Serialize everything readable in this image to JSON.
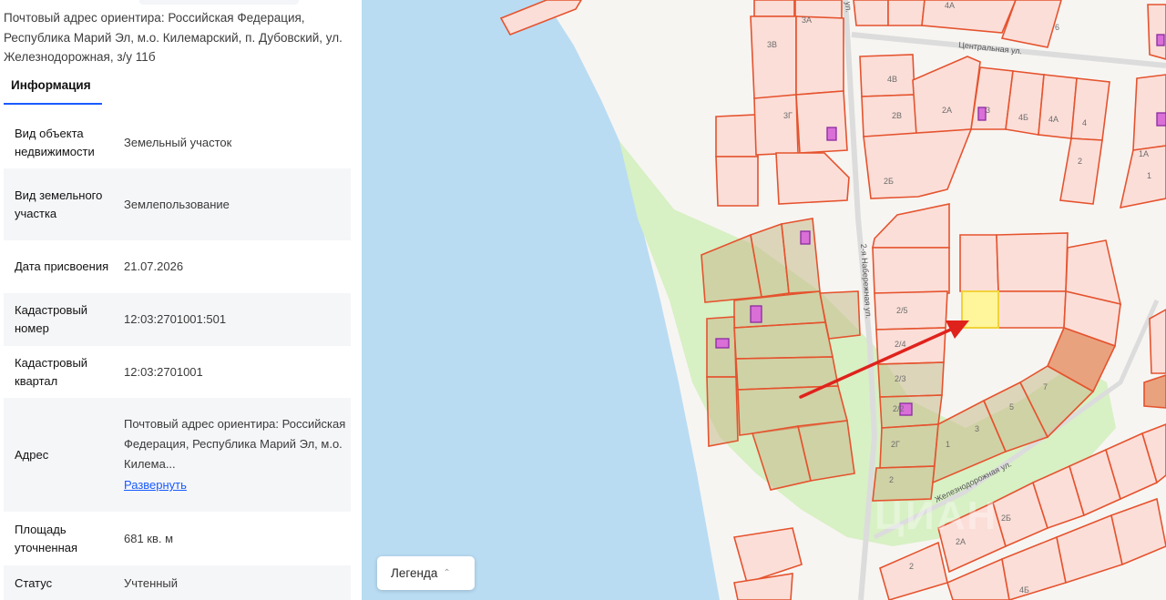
{
  "header": {
    "address_text": "Почтовый адрес ориентира: Российская Федерация, Республика Марий Эл, м.о. Килемарский, п. Дубовский, ул. Железнодорожная, з/у 11б"
  },
  "tabs": [
    {
      "label": "Информация",
      "active": true
    }
  ],
  "info": {
    "rows": [
      {
        "label": "Вид объекта недвижимости",
        "value": "Земельный участок"
      },
      {
        "label": "Вид земельного участка",
        "value": "Землепользование"
      },
      {
        "label": "Дата присвоения",
        "value": "21.07.2026"
      },
      {
        "label": "Кадастровый номер",
        "value": "12:03:2701001:501"
      },
      {
        "label": "Кадастровый квартал",
        "value": "12:03:2701001"
      },
      {
        "label": "Адрес",
        "value": "Почтовый адрес ориентира: Российская Федерация, Республика Марий Эл, м.о. Килема...",
        "link": "Развернуть"
      },
      {
        "label": "Площадь уточненная",
        "value": "681 кв. м"
      },
      {
        "label": "Статус",
        "value": "Учтенный"
      }
    ]
  },
  "map": {
    "legend_label": "Легенда",
    "legend_icon": "chevron-up-icon",
    "watermark": "ЦИАН",
    "streets": [
      "Центральная ул.",
      "2-я Набережная ул.",
      "Железнодорожная ул."
    ],
    "plot_labels": [
      "4А",
      "6",
      "3А",
      "3В",
      "4В",
      "2В",
      "2А",
      "3Г",
      "3",
      "4Б",
      "4А",
      "4",
      "2",
      "1А",
      "1",
      "2Б",
      "2/5",
      "2/4",
      "2/3",
      "2/2",
      "2Г",
      "2",
      "1",
      "3",
      "5",
      "7",
      "2Б",
      "2А",
      "2",
      "4Б"
    ],
    "colors": {
      "water": "#b9dcf3",
      "greenery": "#d7f0c4",
      "plot_fill": "#fbded8",
      "plot_border": "#e5532e",
      "selected_plot": "#fff59a",
      "arrow": "#e0221c",
      "building": "#d96fd7"
    }
  }
}
